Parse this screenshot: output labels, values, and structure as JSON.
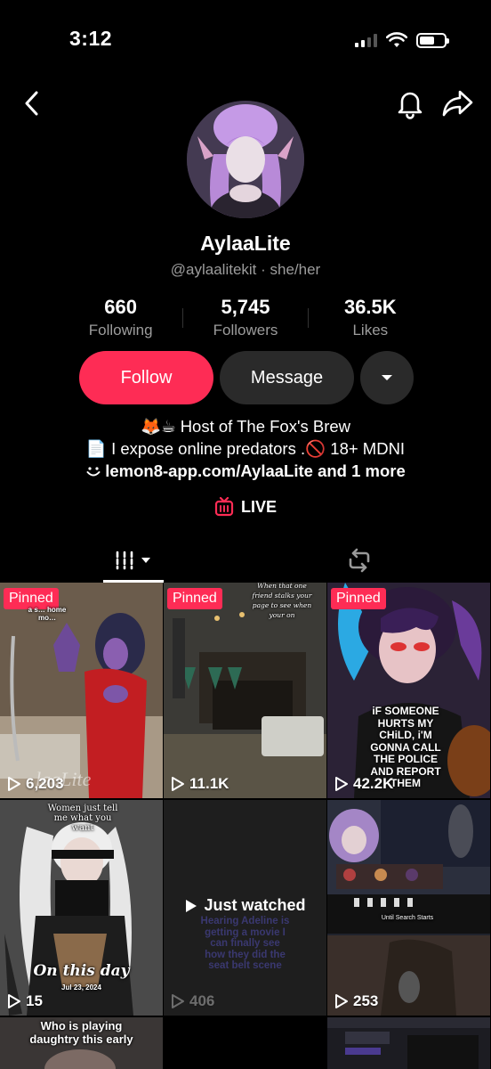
{
  "status_bar": {
    "time": "3:12"
  },
  "profile": {
    "display_name": "AylaaLite",
    "handle": "@aylaalitekit",
    "pronouns": "she/her",
    "separator": " · "
  },
  "stats": {
    "following": {
      "value": "660",
      "label": "Following"
    },
    "followers": {
      "value": "5,745",
      "label": "Followers"
    },
    "likes": {
      "value": "36.5K",
      "label": "Likes"
    }
  },
  "actions": {
    "follow_label": "Follow",
    "message_label": "Message"
  },
  "bio": {
    "line1": "🦊☕ Host of The Fox's Brew",
    "line2": "📄 I expose online predators .🚫 18+ MDNI",
    "link": "lemon8-app.com/AylaaLite",
    "link_more": "and 1 more"
  },
  "live_label": "LIVE",
  "colors": {
    "accent": "#fe2c55",
    "button_dark": "#2a2a2a",
    "muted_text": "#9c9c9c"
  },
  "icons": [
    "back-icon",
    "bell-icon",
    "share-icon",
    "live-tv-icon",
    "grid-icon",
    "chevron-down-icon",
    "repost-icon",
    "play-icon"
  ],
  "videos": [
    {
      "pinned_label": "Pinned",
      "views": "6,203",
      "caption": "a s… home mo…"
    },
    {
      "pinned_label": "Pinned",
      "views": "11.1K",
      "caption": "When that one friend stalks your page to see when your on"
    },
    {
      "pinned_label": "Pinned",
      "views": "42.2K",
      "caption": "iF SOMEONE HURTS MY CHiLD, i'M GONNA CALL THE POLICE AND REPORT THEM"
    },
    {
      "views": "15",
      "caption": "Women just tell me what you want",
      "overlay": "On this day",
      "date": "Jul 23, 2024"
    },
    {
      "views": "406",
      "overlay": "Just watched",
      "caption": "Hearing Adeline is getting a movie I can finally see how they did the seat belt scene"
    },
    {
      "views": "253",
      "caption": "Until Search Starts"
    },
    {
      "caption": "Who is playing daughtry this early"
    }
  ]
}
